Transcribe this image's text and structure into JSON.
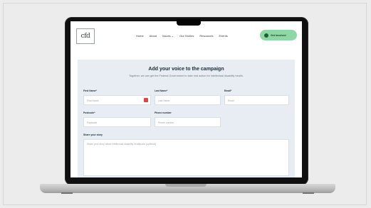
{
  "site": {
    "logo_text": "cfd",
    "nav": [
      "Home",
      "About",
      "Issues ⌄",
      "Our Stories",
      "Resources",
      "Events"
    ],
    "cta_label": "Get Involved"
  },
  "form": {
    "title": "Add your voice to the campaign",
    "subtitle": "Together, we can get the Federal Government to take real action for intellectual disability health.",
    "first_name_label": "First Name*",
    "first_name_placeholder": "First Name",
    "last_name_label": "Last Name*",
    "last_name_placeholder": "Last Name",
    "email_label": "Email*",
    "email_placeholder": "Email",
    "postcode_label": "Postcode*",
    "postcode_placeholder": "Postcode",
    "phone_label": "Phone number",
    "phone_placeholder": "Phone number",
    "story_label": "Share your story",
    "story_placeholder": "Share your story about intellectual disability healthcare (optional)"
  },
  "colors": {
    "accent": "#8fd7a5",
    "panel": "#e7edf2"
  }
}
